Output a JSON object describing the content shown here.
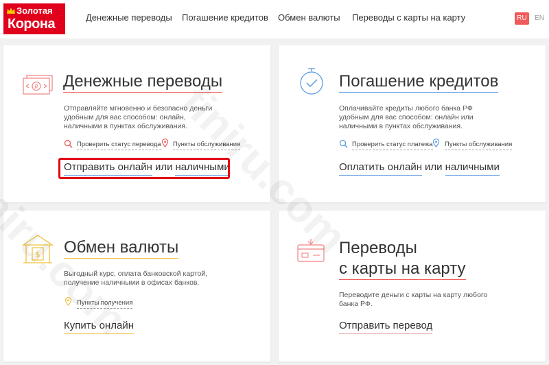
{
  "header": {
    "logo": {
      "line1": "Золотая",
      "line2": "Корона"
    },
    "nav": [
      "Денежные переводы",
      "Погашение кредитов",
      "Обмен валюты",
      "Переводы с карты на карту"
    ],
    "lang": {
      "ru": "RU",
      "en": "EN"
    }
  },
  "cards": {
    "transfers": {
      "title": "Денежные переводы",
      "desc": "Отправляйте мгновенно и безопасно деньги удобным для вас способом: онлайн, наличными в пунктах обслуживания.",
      "link1": "Проверить статус перевода",
      "link2": "Пункты обслуживания",
      "action_online": "Отправить онлайн",
      "action_or": "или",
      "action_cash": "наличными"
    },
    "credits": {
      "title": "Погашение кредитов",
      "desc": "Оплачивайте кредиты любого банка РФ удобным для вас способом: онлайн или наличными в пунктах обслуживания.",
      "link1": "Проверить статус платежа",
      "link2": "Пункты обслуживания",
      "action_online": "Оплатить онлайн",
      "action_or": "или",
      "action_cash": "наличными"
    },
    "exchange": {
      "title": "Обмен валюты",
      "desc": "Выгодный курс, оплата банковской картой, получение наличными в офисах банков.",
      "link1": "Пункты получения",
      "action": "Купить онлайн"
    },
    "card2card": {
      "title_line1": "Переводы",
      "title_line2": "с карты на карту",
      "desc": "Переводите деньги с карты на карту любого банка РФ.",
      "action": "Отправить перевод"
    }
  },
  "watermark": "finiru.com",
  "colors": {
    "brand": "#e0001b",
    "accent_red": "#f05a5a",
    "blue": "#5a9be0",
    "yellow": "#f2c23c"
  }
}
